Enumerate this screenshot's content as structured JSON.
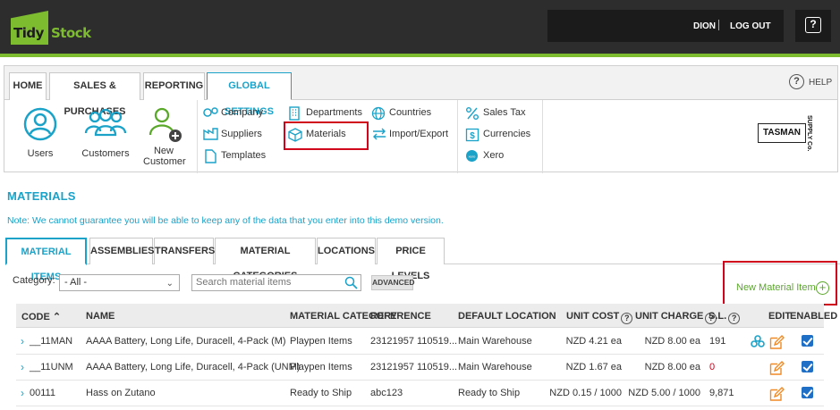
{
  "app": {
    "logo_tidy": "Tidy",
    "logo_stock": "Stock",
    "user": "DION",
    "logout": "LOG OUT",
    "help_btn": "?"
  },
  "main_tabs": [
    "HOME",
    "SALES & PURCHASES",
    "REPORTING",
    "GLOBAL SETTINGS"
  ],
  "help_label": "HELP",
  "ribbon": {
    "big": [
      {
        "label": "Users",
        "icon": "user-icon"
      },
      {
        "label": "Customers",
        "icon": "customers-icon"
      },
      {
        "label": "New\nCustomer",
        "icon": "new-customer-icon"
      }
    ],
    "col1": [
      "Company",
      "Suppliers",
      "Templates"
    ],
    "col2": [
      "Departments",
      "Materials"
    ],
    "col3": [
      "Countries",
      "Import/Export"
    ],
    "col4": [
      "Sales Tax",
      "Currencies",
      "Xero"
    ],
    "brand": "TASMAN",
    "brand_side": "SUPPLY Co."
  },
  "page": {
    "title": "MATERIALS",
    "note": "Note: We cannot guarantee you will be able to keep any of the data that you enter into this demo version."
  },
  "sub_tabs": [
    "MATERIAL ITEMS",
    "ASSEMBLIES",
    "TRANSFERS",
    "MATERIAL CATEGORIES",
    "LOCATIONS",
    "PRICE LEVELS"
  ],
  "filters": {
    "category_label": "Category:",
    "category_value": "- All -",
    "search_placeholder": "Search material items",
    "advanced": "ADVANCED",
    "new_item": "New Material Item",
    "new_item_icon": "+"
  },
  "table": {
    "headers": {
      "code": "CODE",
      "name": "NAME",
      "category": "MATERIAL CATEGORY",
      "reference": "REFERENCE",
      "location": "DEFAULT LOCATION",
      "unit_cost": "UNIT COST",
      "unit_charge": "UNIT CHARGE",
      "sl": "S.L.",
      "edit": "EDIT",
      "enabled": "ENABLED",
      "info_icon": "?"
    },
    "rows": [
      {
        "code": "__11MAN",
        "name": "AAAA Battery, Long Life, Duracell, 4-Pack (M)",
        "category": "Playpen Items",
        "reference": "23121957 110519...",
        "location": "Main Warehouse",
        "unit_cost": "NZD 4.21 ea",
        "unit_charge": "NZD 8.00 ea",
        "sl": "191",
        "sl_red": false,
        "has_assembly": true,
        "enabled": true
      },
      {
        "code": "__11UNM",
        "name": "AAAA Battery, Long Life, Duracell, 4-Pack (UNM)",
        "category": "Playpen Items",
        "reference": "23121957 110519...",
        "location": "Main Warehouse",
        "unit_cost": "NZD 1.67 ea",
        "unit_charge": "NZD 8.00 ea",
        "sl": "0",
        "sl_red": true,
        "has_assembly": false,
        "enabled": true
      },
      {
        "code": "00111",
        "name": "Hass on Zutano",
        "category": "Ready to Ship",
        "reference": "abc123",
        "location": "Ready to Ship",
        "unit_cost": "NZD 0.15 / 1000",
        "unit_charge": "NZD 5.00 / 1000",
        "sl": "9,871",
        "sl_red": false,
        "has_assembly": false,
        "enabled": true
      }
    ]
  },
  "colors": {
    "accent": "#1aa2c8",
    "brand_green": "#7dbb2f",
    "highlight_red": "#d0021b",
    "topbar": "#2d2d2d"
  }
}
